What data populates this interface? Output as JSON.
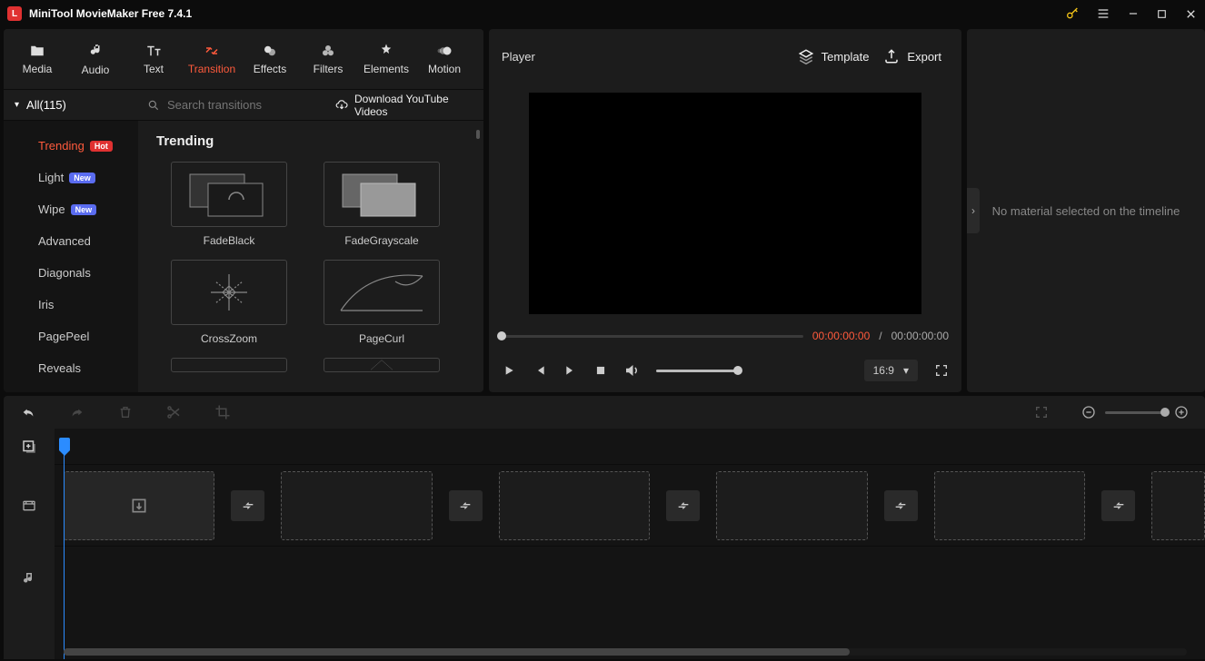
{
  "app": {
    "title": "MiniTool MovieMaker Free 7.4.1"
  },
  "tabs": {
    "media": "Media",
    "audio": "Audio",
    "text": "Text",
    "transition": "Transition",
    "effects": "Effects",
    "filters": "Filters",
    "elements": "Elements",
    "motion": "Motion"
  },
  "category_header": "All(115)",
  "categories": [
    {
      "label": "Trending",
      "badge": "Hot",
      "active": true
    },
    {
      "label": "Light",
      "badge": "New"
    },
    {
      "label": "Wipe",
      "badge": "New"
    },
    {
      "label": "Advanced"
    },
    {
      "label": "Diagonals"
    },
    {
      "label": "Iris"
    },
    {
      "label": "PagePeel"
    },
    {
      "label": "Reveals"
    }
  ],
  "search": {
    "placeholder": "Search transitions"
  },
  "download_link": "Download YouTube Videos",
  "section_title": "Trending",
  "transitions": [
    {
      "name": "FadeBlack"
    },
    {
      "name": "FadeGrayscale"
    },
    {
      "name": "CrossZoom"
    },
    {
      "name": "PageCurl"
    }
  ],
  "player": {
    "title": "Player",
    "template": "Template",
    "export": "Export",
    "time_current": "00:00:00:00",
    "time_sep": "/",
    "time_total": "00:00:00:00",
    "aspect": "16:9"
  },
  "right_panel": {
    "message": "No material selected on the timeline"
  }
}
